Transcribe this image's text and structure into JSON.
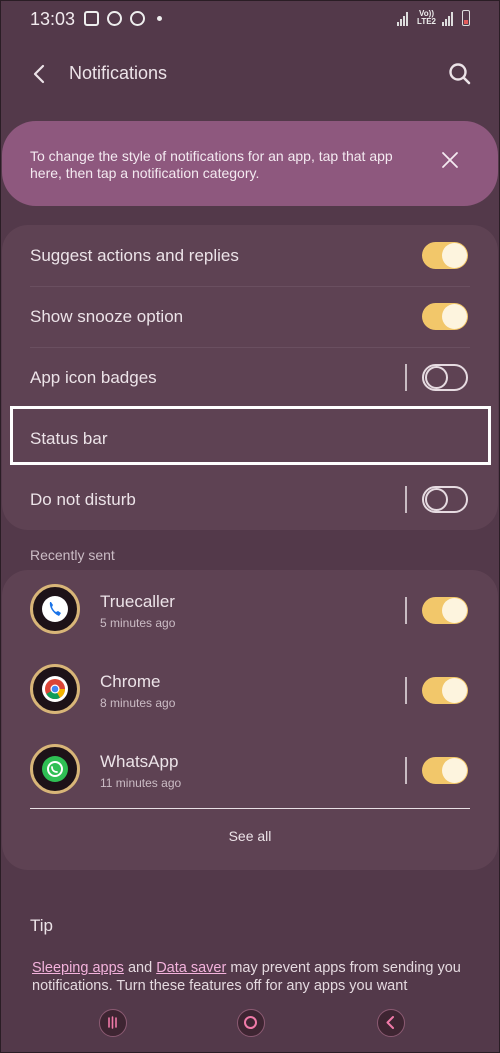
{
  "status_bar": {
    "time": "13:03",
    "network_label": "Vo)) LTE2"
  },
  "header": {
    "title": "Notifications",
    "back_icon": "chevron-left-icon",
    "search_icon": "search-icon"
  },
  "banner": {
    "text": "To change the style of notifications for an app, tap that app here, then tap a notification category.",
    "close_icon": "close-icon"
  },
  "settings": [
    {
      "label": "Suggest actions and replies",
      "toggle": true
    },
    {
      "label": "Show snooze option",
      "toggle": true
    },
    {
      "label": "App icon badges",
      "toggle": false
    },
    {
      "label": "Status bar"
    },
    {
      "label": "Do not disturb",
      "toggle": false
    }
  ],
  "recently_sent": {
    "title": "Recently sent",
    "apps": [
      {
        "name": "Truecaller",
        "time": "5 minutes ago",
        "toggle": true,
        "icon": "truecaller-icon",
        "icon_color": "#ffffff"
      },
      {
        "name": "Chrome",
        "time": "8 minutes ago",
        "toggle": true,
        "icon": "chrome-icon",
        "icon_color": "#ffffff"
      },
      {
        "name": "WhatsApp",
        "time": "11 minutes ago",
        "toggle": true,
        "icon": "whatsapp-icon",
        "icon_color": "#2fbf54"
      }
    ],
    "see_all": "See all"
  },
  "tip": {
    "title": "Tip",
    "link1": "Sleeping apps",
    "and": "and",
    "link2": "Data saver",
    "text_rest": "may prevent apps from sending you notifications. Turn these features off for any apps you want"
  },
  "colors": {
    "background": "#53394a",
    "card": "#5e4253",
    "banner": "#8e587e",
    "toggle_on": "#f2c76a"
  }
}
